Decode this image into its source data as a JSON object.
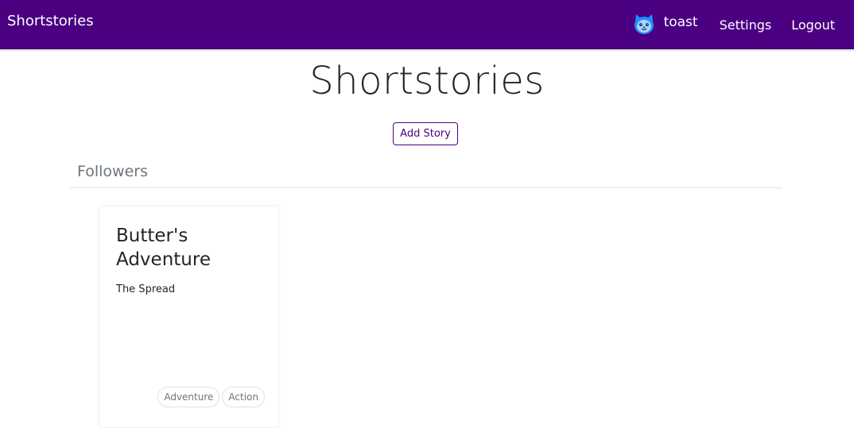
{
  "navbar": {
    "brand": "Shortstories",
    "username": "toast",
    "links": {
      "settings": "Settings",
      "logout": "Logout"
    },
    "background_color": "#4b0082",
    "avatar_icon": "cat-face-icon"
  },
  "main": {
    "title": "Shortstories",
    "add_story_label": "Add Story",
    "section_heading": "Followers"
  },
  "stories": [
    {
      "title": "Butter's Adventure",
      "subtitle": "The Spread",
      "tags": [
        "Adventure",
        "Action"
      ]
    }
  ],
  "colors": {
    "accent": "#4b0082",
    "muted_text": "#6c757d"
  }
}
